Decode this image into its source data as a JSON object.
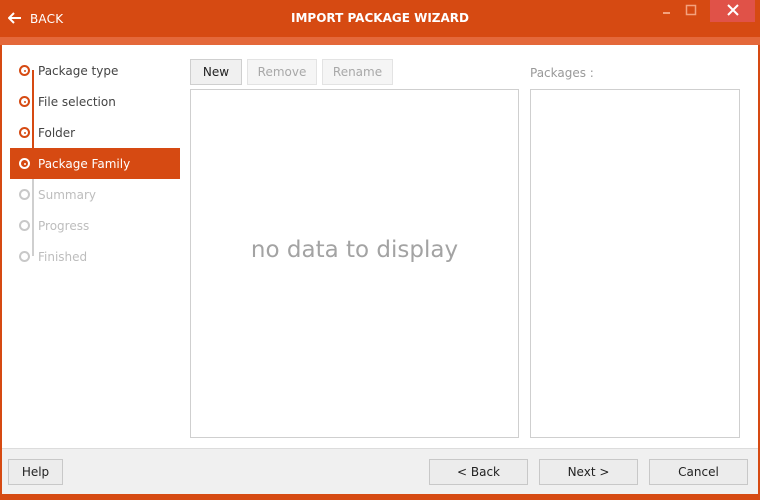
{
  "window": {
    "title": "IMPORT PACKAGE WIZARD",
    "back_label": "BACK",
    "controls": {
      "minimize": "minimize",
      "maximize": "maximize",
      "close": "close"
    },
    "accent_color": "#d64a12"
  },
  "steps": [
    {
      "label": "Package type",
      "state": "done"
    },
    {
      "label": "File selection",
      "state": "done"
    },
    {
      "label": "Folder",
      "state": "done"
    },
    {
      "label": "Package Family",
      "state": "active"
    },
    {
      "label": "Summary",
      "state": "pending"
    },
    {
      "label": "Progress",
      "state": "pending"
    },
    {
      "label": "Finished",
      "state": "pending"
    }
  ],
  "toolbar": {
    "new_label": "New",
    "remove_label": "Remove",
    "rename_label": "Rename"
  },
  "families_list": {
    "empty_text": "no data to display"
  },
  "packages": {
    "label": "Packages :"
  },
  "footer": {
    "help_label": "Help",
    "back_label": "< Back",
    "next_label": "Next >",
    "cancel_label": "Cancel"
  }
}
